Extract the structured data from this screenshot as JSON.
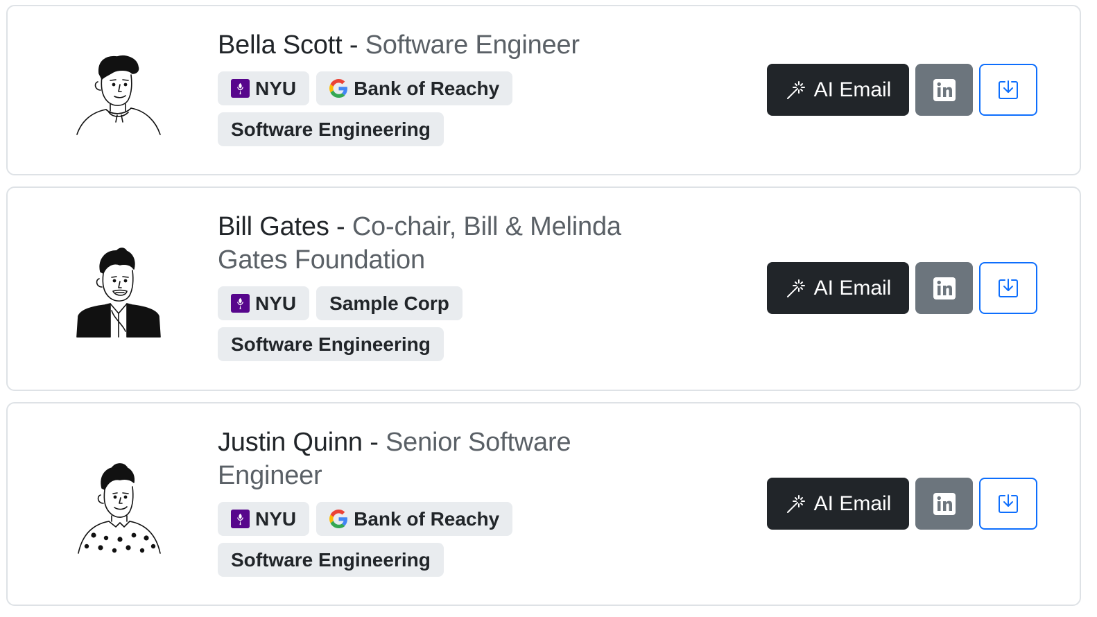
{
  "colors": {
    "primary": "#0d6efd",
    "dark": "#212529",
    "secondary": "#6c757d",
    "tag_bg": "#e9ecef",
    "nyu_purple": "#57068c"
  },
  "contacts": [
    {
      "name": "Bella Scott",
      "separator": "-",
      "title": "Software Engineer",
      "avatar_icon": "person-illustration-icon",
      "tags": [
        {
          "label": "NYU",
          "icon": "nyu-torch-icon"
        },
        {
          "label": "Bank of Reachy",
          "icon": "google-g-icon"
        },
        {
          "label": "Software Engineering",
          "icon": ""
        }
      ],
      "ai_email_label": "AI Email"
    },
    {
      "name": "Bill Gates",
      "separator": "-",
      "title": "Co-chair, Bill & Melinda Gates Foundation",
      "avatar_icon": "person-illustration-icon",
      "tags": [
        {
          "label": "NYU",
          "icon": "nyu-torch-icon"
        },
        {
          "label": "Sample Corp",
          "icon": ""
        },
        {
          "label": "Software Engineering",
          "icon": ""
        }
      ],
      "ai_email_label": "AI Email"
    },
    {
      "name": "Justin Quinn",
      "separator": "-",
      "title": "Senior Software Engineer",
      "avatar_icon": "person-illustration-icon",
      "tags": [
        {
          "label": "NYU",
          "icon": "nyu-torch-icon"
        },
        {
          "label": "Bank of Reachy",
          "icon": "google-g-icon"
        },
        {
          "label": "Software Engineering",
          "icon": ""
        }
      ],
      "ai_email_label": "AI Email"
    }
  ]
}
